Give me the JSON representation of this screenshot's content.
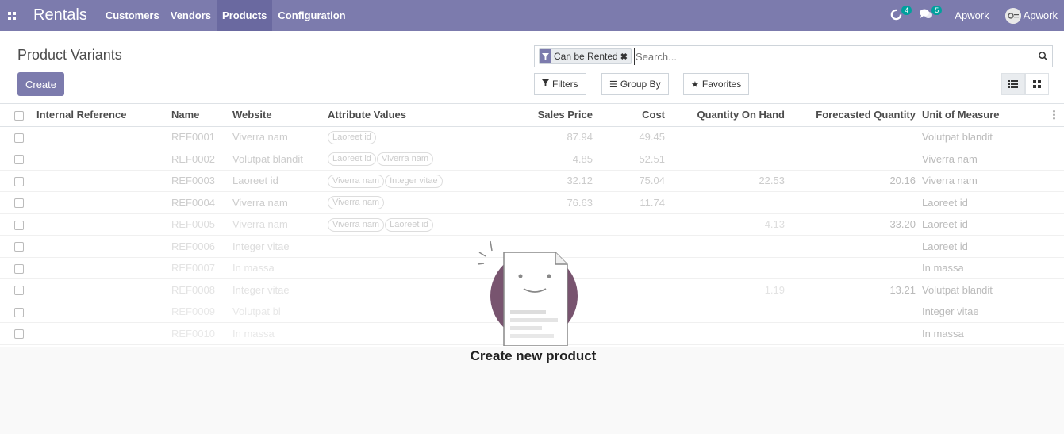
{
  "navbar": {
    "brand": "Rentals",
    "menu": [
      {
        "label": "Customers"
      },
      {
        "label": "Vendors"
      },
      {
        "label": "Products",
        "active": true
      },
      {
        "label": "Configuration"
      }
    ],
    "activity_count": "4",
    "messages_count": "5",
    "company": "Apwork",
    "user": "Apwork",
    "accent_color": "#7c7bad"
  },
  "control_panel": {
    "title": "Product Variants",
    "create_label": "Create",
    "facet_label": "Can be Rented",
    "search_placeholder": "Search...",
    "filters_label": "Filters",
    "groupby_label": "Group By",
    "favorites_label": "Favorites"
  },
  "table": {
    "columns": [
      "Internal Reference",
      "Name",
      "Website",
      "Attribute Values",
      "Sales Price",
      "Cost",
      "Quantity On Hand",
      "Forecasted Quantity",
      "Unit of Measure"
    ],
    "rows": [
      {
        "name": "REF0001",
        "website": "Viverra nam",
        "tags": [
          "Laoreet id"
        ],
        "price": "87.94",
        "cost": "49.45",
        "qty": "",
        "forecast": "",
        "uom": "Volutpat blandit"
      },
      {
        "name": "REF0002",
        "website": "Volutpat blandit",
        "tags": [
          "Laoreet id",
          "Viverra nam"
        ],
        "price": "4.85",
        "cost": "52.51",
        "qty": "",
        "forecast": "",
        "uom": "Viverra nam"
      },
      {
        "name": "REF0003",
        "website": "Laoreet id",
        "tags": [
          "Viverra nam",
          "Integer vitae"
        ],
        "price": "32.12",
        "cost": "75.04",
        "qty": "22.53",
        "forecast": "20.16",
        "uom": "Viverra nam"
      },
      {
        "name": "REF0004",
        "website": "Viverra nam",
        "tags": [
          "Viverra nam"
        ],
        "price": "76.63",
        "cost": "11.74",
        "qty": "",
        "forecast": "",
        "uom": "Laoreet id"
      },
      {
        "name": "REF0005",
        "website": "Viverra nam",
        "tags": [
          "Viverra nam",
          "Laoreet id"
        ],
        "price": "",
        "cost": "",
        "qty": "4.13",
        "forecast": "33.20",
        "uom": "Laoreet id"
      },
      {
        "name": "REF0006",
        "website": "Integer vitae",
        "tags": [],
        "price": "",
        "cost": "",
        "qty": "",
        "forecast": "",
        "uom": "Laoreet id"
      },
      {
        "name": "REF0007",
        "website": "In massa",
        "tags": [],
        "price": "",
        "cost": "",
        "qty": "",
        "forecast": "",
        "uom": "In massa"
      },
      {
        "name": "REF0008",
        "website": "Integer vitae",
        "tags": [],
        "price": "",
        "cost": "",
        "qty": "1.19",
        "forecast": "13.21",
        "uom": "Volutpat blandit"
      },
      {
        "name": "REF0009",
        "website": "Volutpat bl",
        "tags": [],
        "price": "",
        "cost": "",
        "qty": "",
        "forecast": "",
        "uom": "Integer vitae"
      },
      {
        "name": "REF0010",
        "website": "In massa",
        "tags": [],
        "price": "",
        "cost": "",
        "qty": "",
        "forecast": "",
        "uom": "In massa"
      }
    ]
  },
  "helper": {
    "title": "Create new product",
    "illustration_color": "#714b67"
  }
}
